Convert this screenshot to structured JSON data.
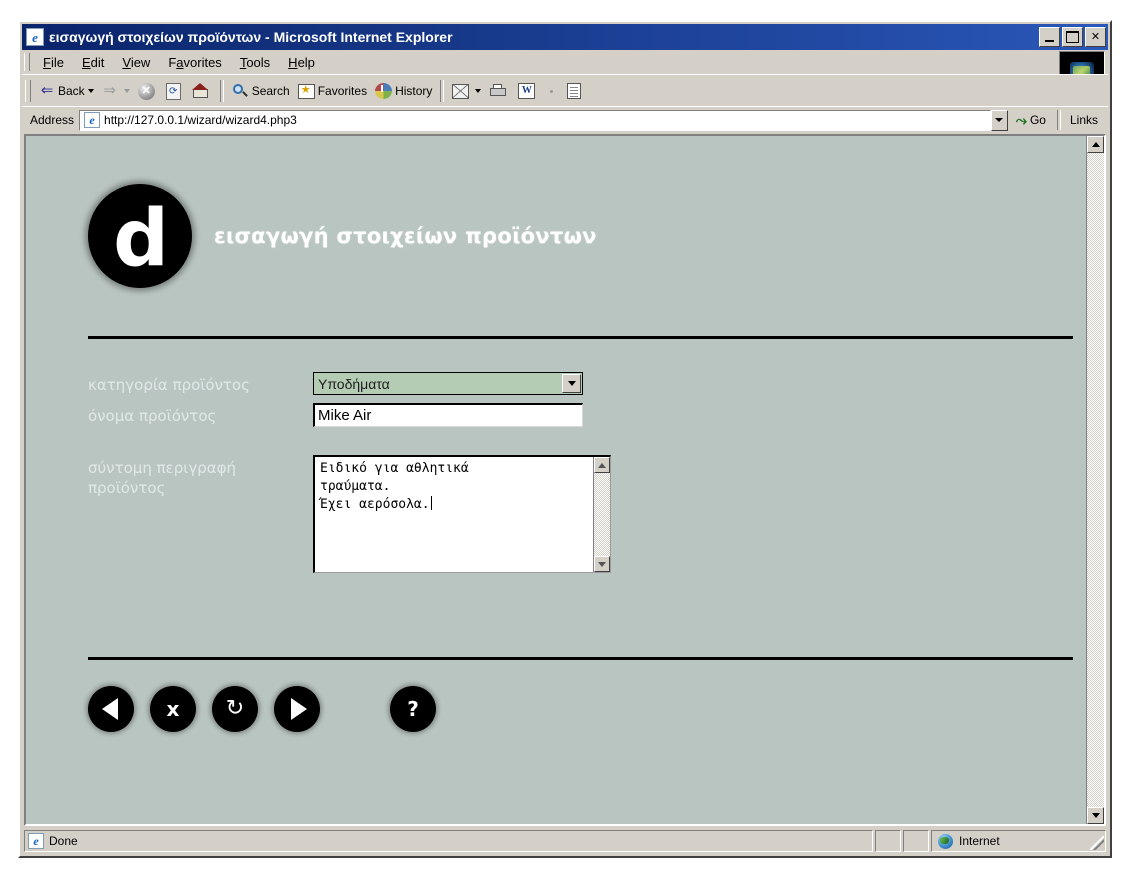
{
  "window": {
    "title": "εισαγωγή στοιχείων προϊόντων - Microsoft Internet Explorer",
    "app_icon": "ie-document-icon",
    "minimize_label": "_",
    "maximize_label": "□",
    "close_label": "✕"
  },
  "menubar": {
    "items": [
      {
        "pre": "",
        "accel": "F",
        "post": "ile"
      },
      {
        "pre": "",
        "accel": "E",
        "post": "dit"
      },
      {
        "pre": "",
        "accel": "V",
        "post": "iew"
      },
      {
        "pre": "F",
        "accel": "a",
        "post": "vorites"
      },
      {
        "pre": "",
        "accel": "T",
        "post": "ools"
      },
      {
        "pre": "",
        "accel": "H",
        "post": "elp"
      }
    ]
  },
  "toolbar": {
    "back_label": "Back",
    "forward_label": "",
    "stop_label": "",
    "refresh_label": "",
    "home_label": "",
    "search_label": "Search",
    "favorites_label": "Favorites",
    "history_label": "History",
    "mail_label": "",
    "print_label": "",
    "edit_label": "",
    "discuss_label": ""
  },
  "address": {
    "label": "Address",
    "url": "http://127.0.0.1/wizard/wizard4.php3",
    "go_label": "Go",
    "go_glyph": "⤳",
    "links_label": "Links"
  },
  "page": {
    "logo_letter": "d",
    "heading": "εισαγωγή στοιχείων προϊόντων",
    "fields": [
      {
        "label": "κατηγορία προϊόντος",
        "type": "select",
        "value": "Υποδήματα"
      },
      {
        "label": "όνομα προϊόντος",
        "type": "text",
        "value": "Mike Air"
      },
      {
        "label": "σύντομη περιγραφή προϊόντος",
        "type": "textarea",
        "value": "Ειδικό για αθλητικά\nτραύματα.\nΈχει αερόσολα."
      }
    ],
    "buttons": [
      {
        "name": "previous",
        "glyph": "◀"
      },
      {
        "name": "cancel",
        "glyph": "x"
      },
      {
        "name": "reset",
        "glyph": "↻"
      },
      {
        "name": "next",
        "glyph": "▶"
      },
      {
        "name": "help",
        "glyph": "?"
      }
    ],
    "colors": {
      "background": "#b9c5c1",
      "select_background": "#b4ccb4",
      "rule": "#000000",
      "label_text": "#e4eceb",
      "heading_text": "#ffffff"
    }
  },
  "statusbar": {
    "message": "Done",
    "zone": "Internet"
  }
}
